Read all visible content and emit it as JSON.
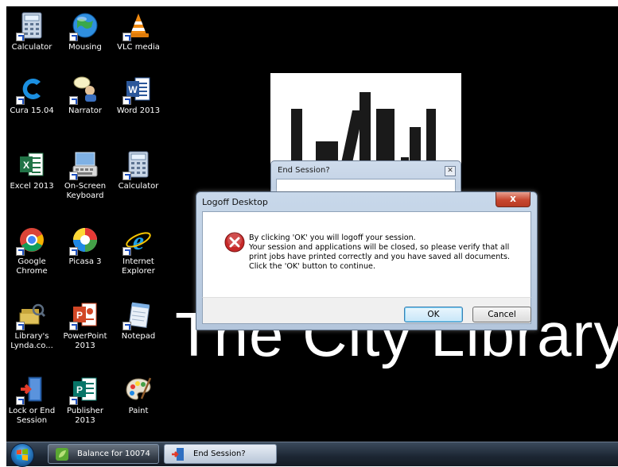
{
  "desktop": {
    "icons": [
      {
        "label": "Calculator",
        "icon": "calculator-icon"
      },
      {
        "label": "Mousing",
        "icon": "globe-icon"
      },
      {
        "label": "VLC media",
        "icon": "vlc-cone-icon"
      },
      {
        "label": "Cura 15.04",
        "icon": "cura-icon"
      },
      {
        "label": "Narrator",
        "icon": "narrator-icon"
      },
      {
        "label": "Word 2013",
        "icon": "word-icon"
      },
      {
        "label": "Excel 2013",
        "icon": "excel-icon"
      },
      {
        "label": "On-Screen Keyboard",
        "icon": "keyboard-icon"
      },
      {
        "label": "Calculator",
        "icon": "calculator-icon"
      },
      {
        "label": "Google Chrome",
        "icon": "chrome-icon"
      },
      {
        "label": "Picasa 3",
        "icon": "picasa-icon"
      },
      {
        "label": "Internet Explorer",
        "icon": "ie-icon"
      },
      {
        "label": "Library's Lynda.co...",
        "icon": "lynda-icon"
      },
      {
        "label": "PowerPoint 2013",
        "icon": "powerpoint-icon"
      },
      {
        "label": "Notepad",
        "icon": "notepad-icon"
      },
      {
        "label": "Lock or End Session",
        "icon": "lock-door-icon"
      },
      {
        "label": "Publisher 2013",
        "icon": "publisher-icon"
      },
      {
        "label": "Paint",
        "icon": "paint-palette-icon"
      }
    ],
    "watermark": "The City Library"
  },
  "background_window": {
    "title": "End Session?"
  },
  "dialog": {
    "title": "Logoff Desktop",
    "close_label": "x",
    "message_lines": [
      "By clicking 'OK' you will logoff your session.",
      "Your session and applications will be closed, so please verify that all",
      "print jobs have printed correctly and you have saved all documents.",
      "Click the 'OK' button to continue."
    ],
    "ok_label": "OK",
    "cancel_label": "Cancel"
  },
  "taskbar": {
    "items": [
      {
        "label": "Balance for 10074",
        "icon": "balance-icon"
      },
      {
        "label": "End Session?",
        "icon": "lock-door-icon"
      }
    ]
  },
  "colors": {
    "desktop_bg": "#000000",
    "dialog_frame": "#b4c6dc",
    "close_button": "#c7472f",
    "error_icon": "#c62828"
  }
}
